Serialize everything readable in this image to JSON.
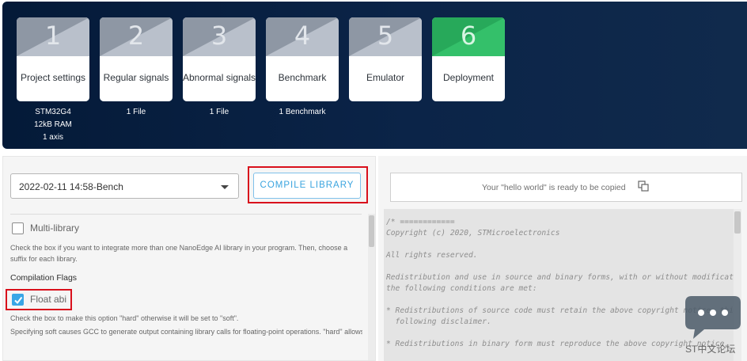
{
  "steps": [
    {
      "number": "1",
      "title": "Project settings",
      "sub": [
        "STM32G4",
        "12kB RAM",
        "1 axis"
      ]
    },
    {
      "number": "2",
      "title": "Regular signals",
      "sub": [
        "1 File"
      ]
    },
    {
      "number": "3",
      "title": "Abnormal signals",
      "sub": [
        "1 File"
      ]
    },
    {
      "number": "4",
      "title": "Benchmark",
      "sub": [
        "1 Benchmark"
      ]
    },
    {
      "number": "5",
      "title": "Emulator",
      "sub": []
    },
    {
      "number": "6",
      "title": "Deployment",
      "sub": []
    }
  ],
  "left": {
    "benchmark_select": "2022-02-11 14:58-Bench",
    "compile_button": "COMPILE LIBRARY",
    "multi_library_label": "Multi-library",
    "multi_library_checked": false,
    "multi_library_desc": "Check the box if you want to integrate more than one NanoEdge AI library in your program. Then, choose a suffix for each library.",
    "flags_title": "Compilation Flags",
    "float_abi_label": "Float abi",
    "float_abi_checked": true,
    "float_abi_desc1": "Check the box to make this option \"hard\" otherwise it will be set to \"soft\".",
    "float_abi_desc2": "Specifying soft causes GCC to generate output containing library calls for floating-point operations. \"hard\" allows"
  },
  "right": {
    "hello_world": "Your \"hello world\" is ready to be copied",
    "code_lines": [
      "/* ============",
      "Copyright (c) 2020, STMicroelectronics",
      "",
      "All rights reserved.",
      "",
      "Redistribution and use in source and binary forms, with or without modificat:",
      "the following conditions are met:",
      "",
      "* Redistributions of source code must retain the above copyright notice, thi",
      "  following disclaimer.",
      "",
      "* Redistributions in binary form must reproduce the above copyright notice,"
    ]
  },
  "watermark": "ST中文论坛",
  "colors": {
    "header_bg": "#0b2448",
    "active_step": "#34c06a",
    "inactive_step": "#b9c0cb",
    "accent": "#38a6e6",
    "highlight": "#d9101c"
  }
}
